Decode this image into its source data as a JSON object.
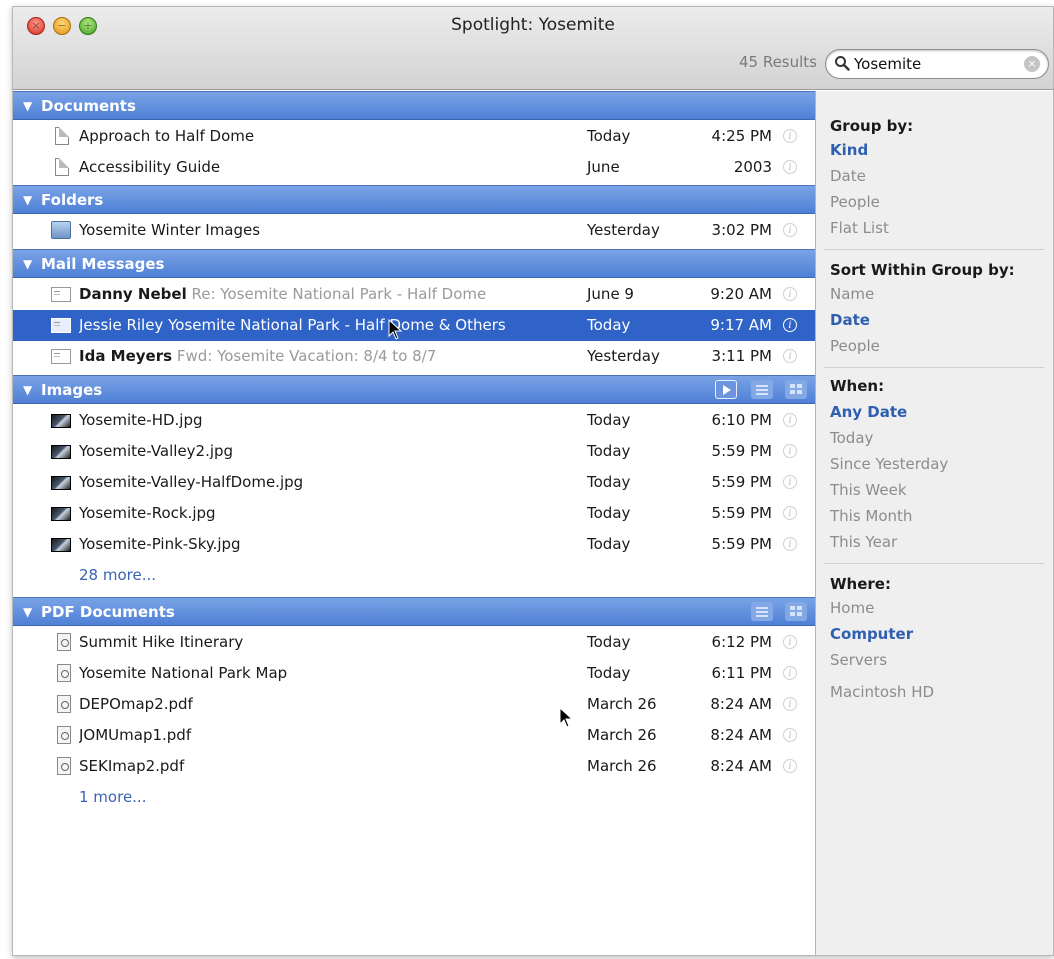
{
  "window": {
    "title": "Spotlight: Yosemite",
    "results_count": "45 Results",
    "search_value": "Yosemite"
  },
  "groups": {
    "documents": {
      "title": "Documents",
      "rows": [
        {
          "name": "Approach to Half Dome",
          "sub": "",
          "date": "Today",
          "time": "4:25 PM"
        },
        {
          "name": "Accessibility Guide",
          "sub": "",
          "date": "June",
          "time": "2003"
        }
      ]
    },
    "folders": {
      "title": "Folders",
      "rows": [
        {
          "name": "Yosemite Winter Images",
          "sub": "",
          "date": "Yesterday",
          "time": "3:02 PM"
        }
      ]
    },
    "mail": {
      "title": "Mail Messages",
      "rows": [
        {
          "name": "Danny Nebel",
          "sub": "Re: Yosemite National Park - Half Dome",
          "date": "June 9",
          "time": "9:20 AM"
        },
        {
          "name": "Jessie Riley",
          "sub": "Yosemite National Park - Half Dome & Others",
          "date": "Today",
          "time": "9:17 AM"
        },
        {
          "name": "Ida Meyers",
          "sub": "Fwd: Yosemite Vacation: 8/4 to 8/7",
          "date": "Yesterday",
          "time": "3:11 PM"
        }
      ]
    },
    "images": {
      "title": "Images",
      "rows": [
        {
          "name": "Yosemite-HD.jpg",
          "sub": "",
          "date": "Today",
          "time": "6:10 PM"
        },
        {
          "name": "Yosemite-Valley2.jpg",
          "sub": "",
          "date": "Today",
          "time": "5:59 PM"
        },
        {
          "name": "Yosemite-Valley-HalfDome.jpg",
          "sub": "",
          "date": "Today",
          "time": "5:59 PM"
        },
        {
          "name": "Yosemite-Rock.jpg",
          "sub": "",
          "date": "Today",
          "time": "5:59 PM"
        },
        {
          "name": "Yosemite-Pink-Sky.jpg",
          "sub": "",
          "date": "Today",
          "time": "5:59 PM"
        }
      ],
      "more": "28 more..."
    },
    "pdf": {
      "title": "PDF Documents",
      "rows": [
        {
          "name": "Summit Hike Itinerary",
          "sub": "",
          "date": "Today",
          "time": "6:12 PM"
        },
        {
          "name": "Yosemite National Park Map",
          "sub": "",
          "date": "Today",
          "time": "6:11 PM"
        },
        {
          "name": "DEPOmap2.pdf",
          "sub": "",
          "date": "March 26",
          "time": "8:24 AM"
        },
        {
          "name": "JOMUmap1.pdf",
          "sub": "",
          "date": "March 26",
          "time": "8:24 AM"
        },
        {
          "name": "SEKImap2.pdf",
          "sub": "",
          "date": "March 26",
          "time": "8:24 AM"
        }
      ],
      "more": "1 more..."
    }
  },
  "sidebar": {
    "group_by": {
      "label": "Group by:",
      "options": [
        "Kind",
        "Date",
        "People",
        "Flat List"
      ],
      "selected": "Kind"
    },
    "sort_within": {
      "label": "Sort Within Group by:",
      "options": [
        "Name",
        "Date",
        "People"
      ],
      "selected": "Date"
    },
    "when": {
      "label": "When:",
      "options": [
        "Any Date",
        "Today",
        "Since Yesterday",
        "This Week",
        "This Month",
        "This Year"
      ],
      "selected": "Any Date"
    },
    "where": {
      "label": "Where:",
      "options": [
        "Home",
        "Computer",
        "Servers",
        "Macintosh HD"
      ],
      "selected": "Computer"
    }
  },
  "colors": {
    "group_header": "#5a88d8",
    "selected_row": "#2f63c7",
    "active_option": "#2e5fb0",
    "link": "#3b63b3"
  },
  "icons": {
    "documents": "document-icon",
    "folders": "folder-icon",
    "mail": "mail-icon",
    "images": "image-thumbnail-icon",
    "pdf": "pdf-icon",
    "info": "info-icon"
  }
}
